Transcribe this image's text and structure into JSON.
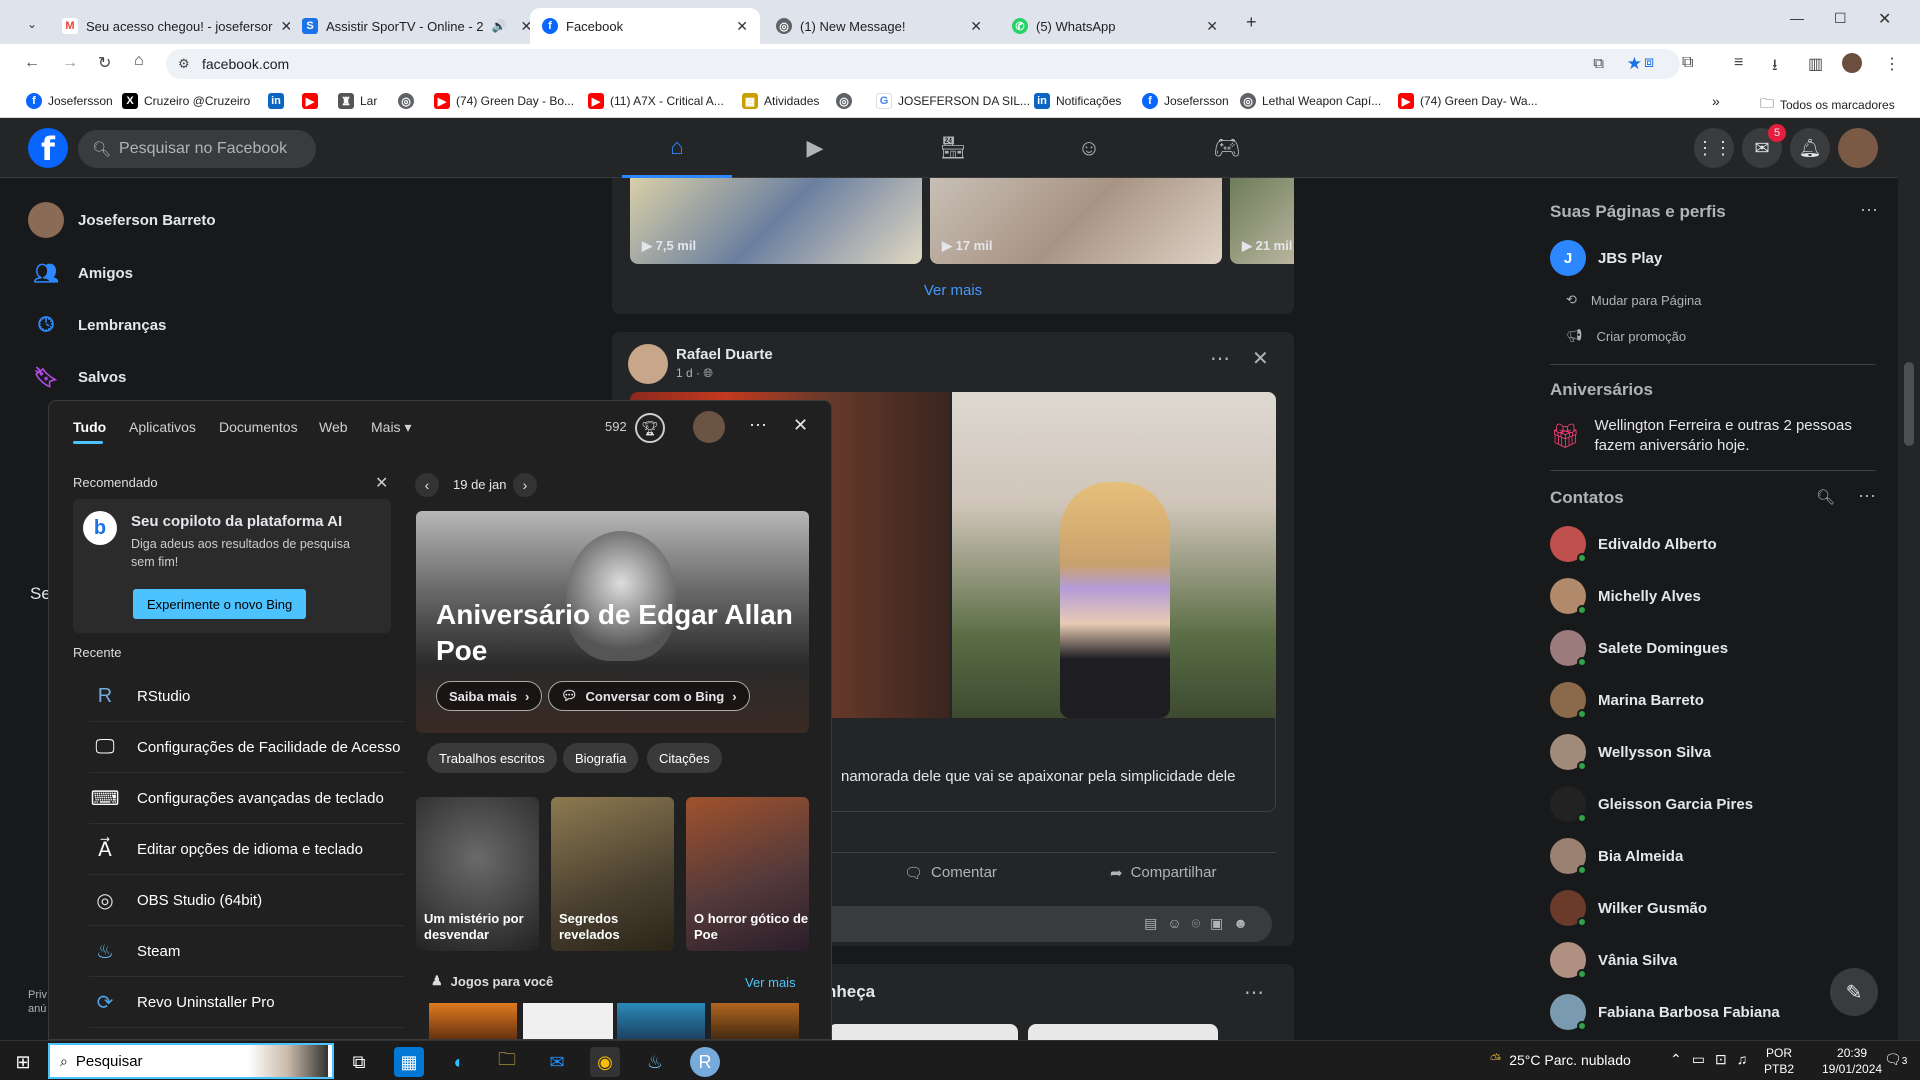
{
  "browser": {
    "tabs": [
      {
        "title": "Seu acesso chegou! - josefersor",
        "icon": "gmail-icon",
        "icon_color": "#ea4335"
      },
      {
        "title": "Assistir SporTV - Online - 2",
        "icon": "sportv-icon",
        "icon_color": "#1a73e8"
      },
      {
        "title": "Facebook",
        "icon": "facebook-icon",
        "icon_color": "#0866ff"
      },
      {
        "title": "(1) New Message!",
        "icon": "globe-icon",
        "icon_color": "#5f6368"
      },
      {
        "title": "(5) WhatsApp",
        "icon": "whatsapp-icon",
        "icon_color": "#25d366"
      }
    ],
    "url": "facebook.com",
    "bookmarks": [
      "Josefersson",
      "Cruzeiro @Cruzeiro",
      "",
      "",
      "Lar",
      "",
      "(74) Green Day - Bo...",
      "(11) A7X - Critical A...",
      "Atividades",
      "",
      "JOSEFERSON DA SIL...",
      "Notificações",
      "Josefersson",
      "Lethal Weapon Capí...",
      "(74) Green Day- Wa..."
    ],
    "all_bookmarks": "Todos os marcadores"
  },
  "fb": {
    "search_placeholder": "Pesquisar no Facebook",
    "messenger_badge": "5",
    "left_nav": [
      {
        "label": "Joseferson Barreto"
      },
      {
        "label": "Amigos"
      },
      {
        "label": "Lembranças"
      },
      {
        "label": "Salvos"
      }
    ],
    "left_partial": "Se",
    "left_footer": "Priv anú",
    "reels": [
      {
        "views": "7,5 mil"
      },
      {
        "views": "17 mil"
      },
      {
        "views": "21 mil"
      }
    ],
    "see_more": "Ver mais",
    "post": {
      "author": "Rafael Duarte",
      "time": "1 d",
      "caption": "namorada dele que vai se apaixonar pela simplicidade dele",
      "comment": "Comentar",
      "share": "Compartilhar"
    },
    "suggest_partial": "nheça",
    "right": {
      "pages_title": "Suas Páginas e perfis",
      "page_name": "JBS Play",
      "page_initial": "J",
      "switch": "Mudar para Página",
      "promo": "Criar promoção",
      "bday_title": "Aniversários",
      "bday_text": "Wellington Ferreira e outras 2 pessoas fazem aniversário hoje.",
      "contacts_title": "Contatos",
      "contacts": [
        "Edivaldo Alberto",
        "Michelly Alves",
        "Salete Domingues",
        "Marina Barreto",
        "Wellysson Silva",
        "Gleisson Garcia Pires",
        "Bia Almeida",
        "Wilker Gusmão",
        "Vânia Silva",
        "Fabiana Barbosa Fabiana"
      ]
    }
  },
  "startmenu": {
    "tabs": [
      "Tudo",
      "Aplicativos",
      "Documentos",
      "Web",
      "Mais"
    ],
    "points": "592",
    "recommended": "Recomendado",
    "copilot_title": "Seu copiloto da plataforma AI",
    "copilot_desc": "Diga adeus aos resultados de pesquisa sem fim!",
    "copilot_btn": "Experimente o novo Bing",
    "recent_title": "Recente",
    "recent": [
      {
        "label": "RStudio",
        "icon": "rstudio-icon"
      },
      {
        "label": "Configurações de Facilidade de Acesso",
        "icon": "monitor-icon"
      },
      {
        "label": "Configurações avançadas de teclado",
        "icon": "keyboard-icon"
      },
      {
        "label": "Editar opções de idioma e teclado",
        "icon": "language-icon"
      },
      {
        "label": "OBS Studio (64bit)",
        "icon": "obs-icon"
      },
      {
        "label": "Steam",
        "icon": "steam-icon"
      },
      {
        "label": "Revo Uninstaller Pro",
        "icon": "revo-icon"
      }
    ],
    "date": "19 de jan",
    "hero_title": "Aniversário de Edgar Allan Poe",
    "learn_more": "Saiba mais",
    "chat_bing": "Conversar com o Bing",
    "chips": [
      "Trabalhos escritos",
      "Biografia",
      "Citações"
    ],
    "tiles": [
      "Um mistério por desvendar",
      "Segredos revelados",
      "O horror gótico de Poe"
    ],
    "games_title": "Jogos para você",
    "games_more": "Ver mais"
  },
  "taskbar": {
    "search": "Pesquisar",
    "weather": "25°C  Parc. nublado",
    "lang1": "POR",
    "lang2": "PTB2",
    "time": "20:39",
    "date": "19/01/2024",
    "notif": "3"
  }
}
